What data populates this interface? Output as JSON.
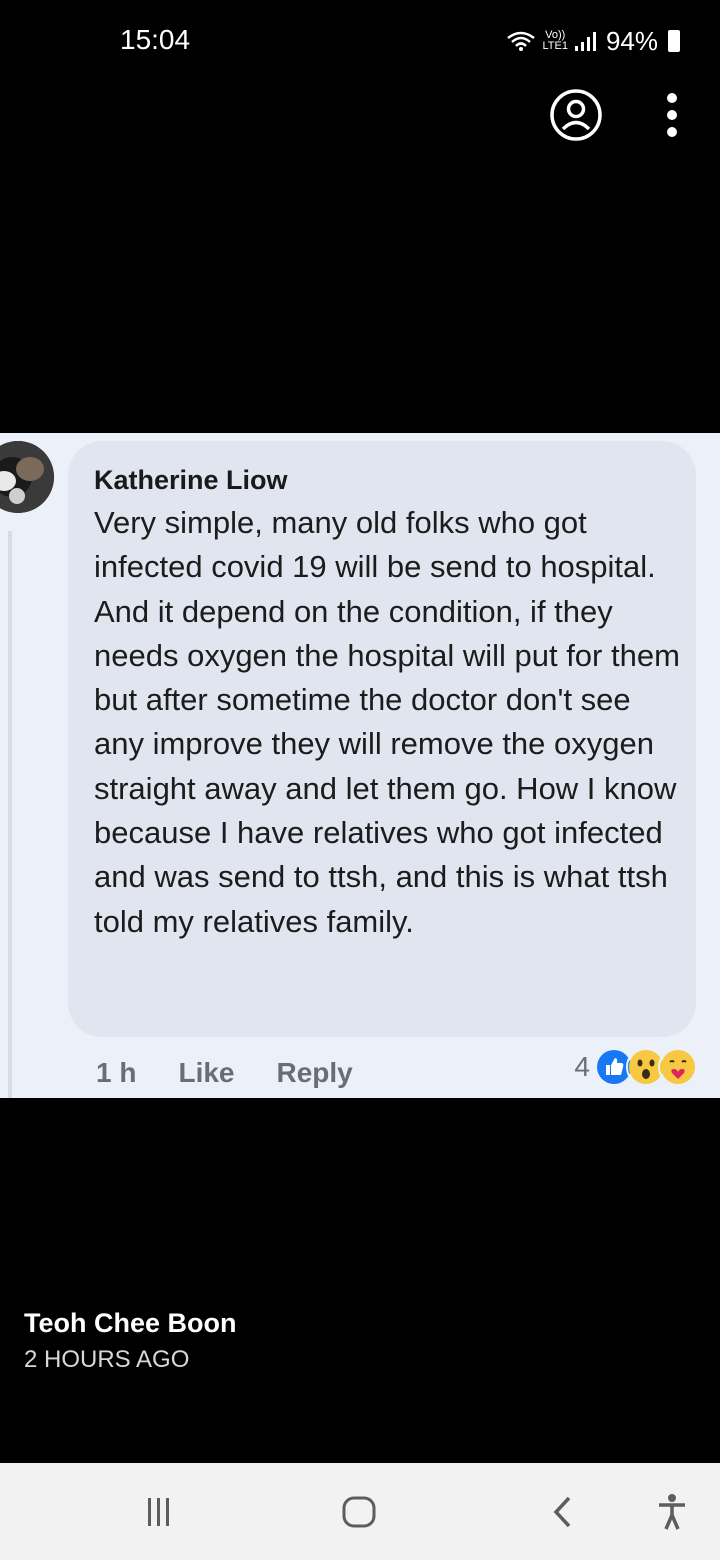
{
  "status_bar": {
    "time": "15:04",
    "network_label": "LTE1",
    "volte_label": "Vo))",
    "battery_percent": "94%"
  },
  "viewer": {
    "profile_icon": "profile-icon",
    "menu_icon": "more-vert-icon"
  },
  "comment": {
    "author": "Katherine Liow",
    "text": "Very simple, many old folks who got infected covid 19 will be send to hospital. And it depend on the condition, if they needs oxygen the hospital will put for them but after sometime the doctor don't see any improve they will remove the oxygen straight away and let them go. How I know because I have relatives who got infected and was send to ttsh, and this is what ttsh told my relatives family.",
    "time": "1 h",
    "like_label": "Like",
    "reply_label": "Reply",
    "reaction_count": "4",
    "reactions": [
      "like-icon",
      "wow-icon",
      "care-icon"
    ]
  },
  "post": {
    "author": "Teoh Chee Boon",
    "time": "2 HOURS AGO"
  },
  "nav": {
    "icons": [
      "recents-icon",
      "home-icon",
      "back-icon",
      "accessibility-icon"
    ]
  },
  "colors": {
    "background": "#000000",
    "bubble": "#e1e5f0",
    "comment_bg": "#ecf0f8",
    "like_blue": "#1877f2",
    "meta_grey": "#6a6d73"
  }
}
